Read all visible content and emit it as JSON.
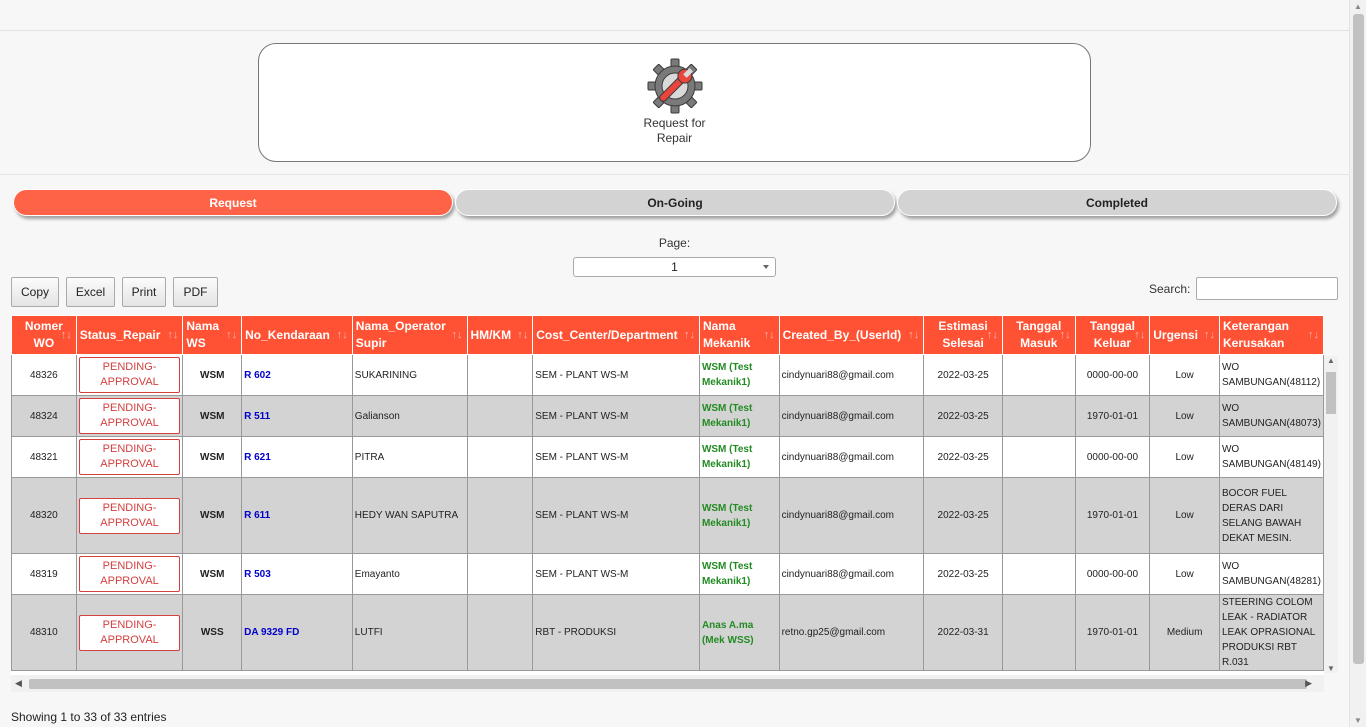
{
  "card": {
    "label": "Request for Repair",
    "icon": "gear-wrench-icon"
  },
  "tabs": [
    {
      "label": "Request",
      "active": true
    },
    {
      "label": "On-Going",
      "active": false
    },
    {
      "label": "Completed",
      "active": false
    }
  ],
  "pagination": {
    "label": "Page:",
    "selected": "1"
  },
  "buttons": {
    "copy": "Copy",
    "excel": "Excel",
    "print": "Print",
    "pdf": "PDF"
  },
  "search": {
    "label": "Search:",
    "value": ""
  },
  "colors": {
    "accent": "#ff6347",
    "header": "#ff5234",
    "link": "#0000cc",
    "mechanic": "#228b22",
    "status": "#d43f3f"
  },
  "table": {
    "columns": [
      {
        "key": "no_wo",
        "label": "Nomer WO"
      },
      {
        "key": "status",
        "label": "Status_Repair"
      },
      {
        "key": "ws",
        "label": "Nama WS"
      },
      {
        "key": "kendaraan",
        "label": "No_Kendaraan"
      },
      {
        "key": "supir",
        "label": "Nama_Operator Supir"
      },
      {
        "key": "hmkm",
        "label": "HM/KM"
      },
      {
        "key": "cost",
        "label": "Cost_Center/Department"
      },
      {
        "key": "mekanik",
        "label": "Nama Mekanik"
      },
      {
        "key": "created",
        "label": "Created_By_(UserId)"
      },
      {
        "key": "estimasi",
        "label": "Estimasi Selesai"
      },
      {
        "key": "masuk",
        "label": "Tanggal Masuk"
      },
      {
        "key": "keluar",
        "label": "Tanggal Keluar"
      },
      {
        "key": "urgensi",
        "label": "Urgensi"
      },
      {
        "key": "keterangan",
        "label": "Keterangan Kerusakan"
      }
    ],
    "rows": [
      {
        "no_wo": "48326",
        "status": "PENDING-APPROVAL",
        "ws": "WSM",
        "kendaraan": "R 602",
        "supir": "SUKARINING",
        "hmkm": "",
        "cost": "SEM - PLANT WS-M",
        "mekanik": "WSM (Test Mekanik1)",
        "created": "cindynuari88@gmail.com",
        "estimasi": "2022-03-25",
        "masuk": "",
        "keluar": "0000-00-00",
        "urgensi": "Low",
        "keterangan": "WO SAMBUNGAN(48112)"
      },
      {
        "no_wo": "48324",
        "status": "PENDING-APPROVAL",
        "ws": "WSM",
        "kendaraan": "R 511",
        "supir": "Galianson",
        "hmkm": "",
        "cost": "SEM - PLANT WS-M",
        "mekanik": "WSM (Test Mekanik1)",
        "created": "cindynuari88@gmail.com",
        "estimasi": "2022-03-25",
        "masuk": "",
        "keluar": "1970-01-01",
        "urgensi": "Low",
        "keterangan": "WO SAMBUNGAN(48073)"
      },
      {
        "no_wo": "48321",
        "status": "PENDING-APPROVAL",
        "ws": "WSM",
        "kendaraan": "R 621",
        "supir": "PITRA",
        "hmkm": "",
        "cost": "SEM - PLANT WS-M",
        "mekanik": "WSM (Test Mekanik1)",
        "created": "cindynuari88@gmail.com",
        "estimasi": "2022-03-25",
        "masuk": "",
        "keluar": "0000-00-00",
        "urgensi": "Low",
        "keterangan": "WO SAMBUNGAN(48149)"
      },
      {
        "no_wo": "48320",
        "status": "PENDING-APPROVAL",
        "ws": "WSM",
        "kendaraan": "R 611",
        "supir": "HEDY WAN SAPUTRA",
        "hmkm": "",
        "cost": "SEM - PLANT WS-M",
        "mekanik": "WSM (Test Mekanik1)",
        "created": "cindynuari88@gmail.com",
        "estimasi": "2022-03-25",
        "masuk": "",
        "keluar": "1970-01-01",
        "urgensi": "Low",
        "keterangan": "BOCOR FUEL DERAS DARI SELANG BAWAH DEKAT MESIN."
      },
      {
        "no_wo": "48319",
        "status": "PENDING-APPROVAL",
        "ws": "WSM",
        "kendaraan": "R 503",
        "supir": "Emayanto",
        "hmkm": "",
        "cost": "SEM - PLANT WS-M",
        "mekanik": "WSM (Test Mekanik1)",
        "created": "cindynuari88@gmail.com",
        "estimasi": "2022-03-25",
        "masuk": "",
        "keluar": "0000-00-00",
        "urgensi": "Low",
        "keterangan": "WO SAMBUNGAN(48281)"
      },
      {
        "no_wo": "48310",
        "status": "PENDING-APPROVAL",
        "ws": "WSS",
        "kendaraan": "DA 9329 FD",
        "supir": "LUTFI",
        "hmkm": "",
        "cost": "RBT - PRODUKSI",
        "mekanik": "Anas A.ma (Mek WSS)",
        "created": "retno.gp25@gmail.com",
        "estimasi": "2022-03-31",
        "masuk": "",
        "keluar": "1970-01-01",
        "urgensi": "Medium",
        "keterangan": "STEERING COLOM LEAK - RADIATOR LEAK OPRASIONAL PRODUKSI RBT R.031"
      }
    ]
  },
  "info": "Showing 1 to 33 of 33 entries"
}
